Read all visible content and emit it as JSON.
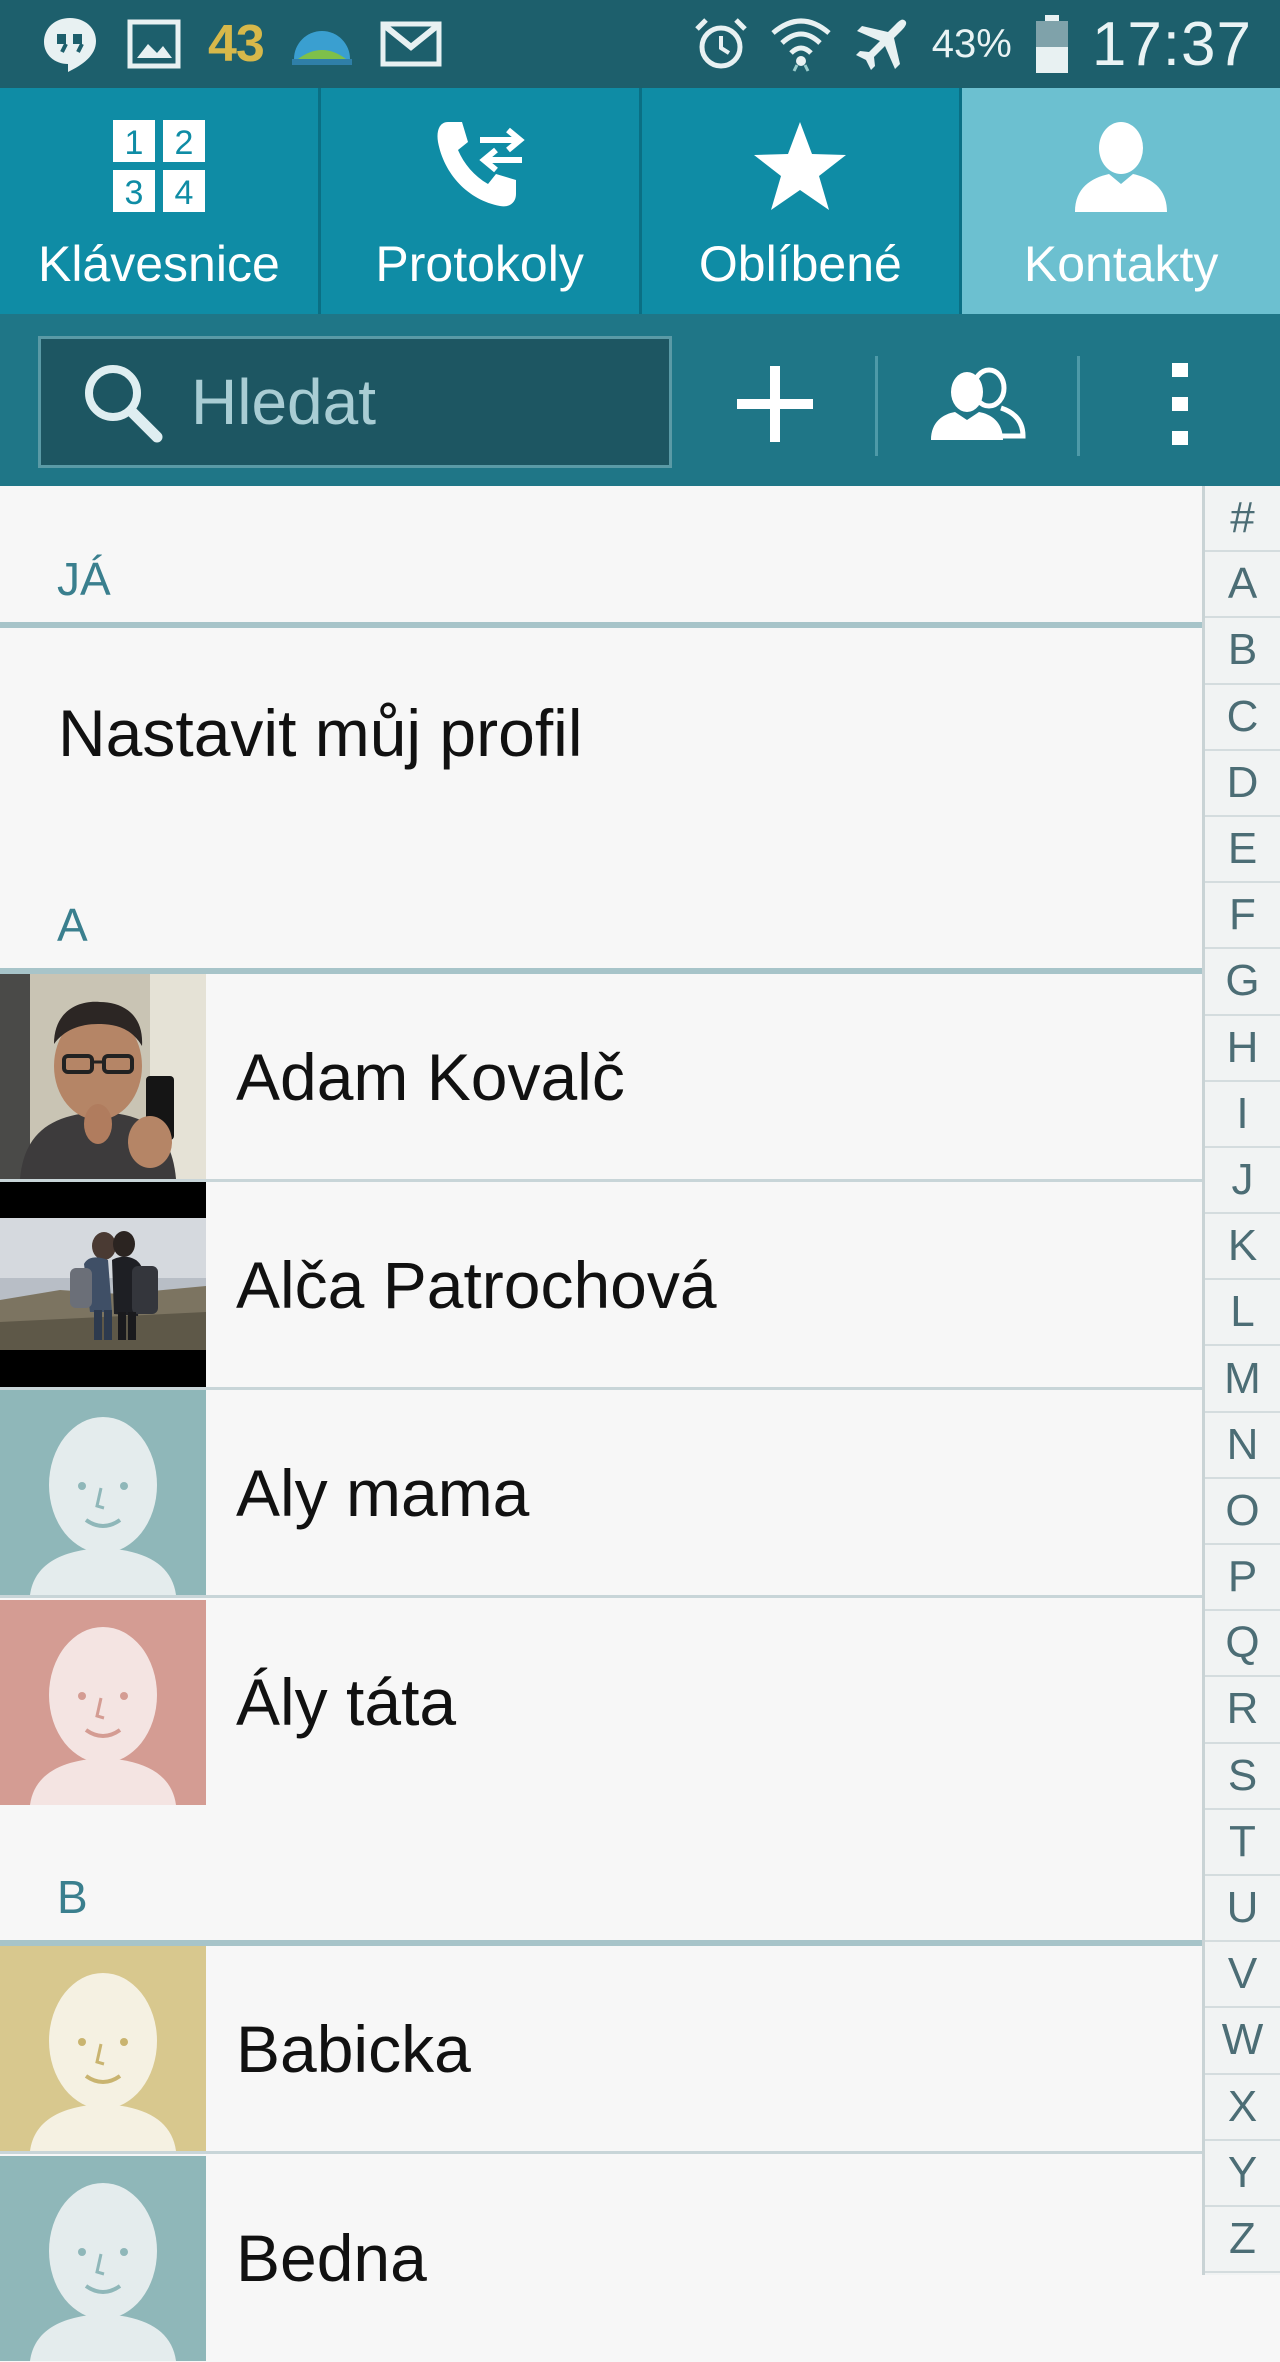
{
  "status_bar": {
    "left_icons": [
      "hangouts-icon",
      "gallery-icon",
      "weather-icon",
      "gmail-icon"
    ],
    "notification_count": "43",
    "right_icons": [
      "alarm-icon",
      "wifi-icon",
      "airplane-icon",
      "battery-icon"
    ],
    "battery_percent": "43%",
    "time": "17:37"
  },
  "tabs": [
    {
      "label": "Klávesnice",
      "icon": "keypad-icon",
      "active": false
    },
    {
      "label": "Protokoly",
      "icon": "call-log-icon",
      "active": false
    },
    {
      "label": "Oblíbené",
      "icon": "star-icon",
      "active": false
    },
    {
      "label": "Kontakty",
      "icon": "person-icon",
      "active": true
    }
  ],
  "toolbar": {
    "search_placeholder": "Hledat",
    "add_icon": "plus-icon",
    "groups_icon": "groups-icon",
    "menu_icon": "more-vertical-icon"
  },
  "sections": {
    "me": {
      "header": "JÁ",
      "profile_label": "Nastavit můj profil"
    },
    "a": {
      "header": "A"
    },
    "b": {
      "header": "B"
    }
  },
  "contacts": [
    {
      "name": "Adam Kovalč",
      "avatar": "photo-avatar"
    },
    {
      "name": "Alča Patrochová",
      "avatar": "photo-avatar"
    },
    {
      "name": "Aly mama",
      "avatar": "default-avatar",
      "avatar_color": "#8fb7b9"
    },
    {
      "name": "Ály táta",
      "avatar": "default-avatar",
      "avatar_color": "#d49c93"
    },
    {
      "name": "Babicka",
      "avatar": "default-avatar",
      "avatar_color": "#d8c88e"
    },
    {
      "name": "Bedna",
      "avatar": "default-avatar",
      "avatar_color": "#8fb7b9"
    }
  ],
  "alphabet_index": [
    "#",
    "A",
    "B",
    "C",
    "D",
    "E",
    "F",
    "G",
    "H",
    "I",
    "J",
    "K",
    "L",
    "M",
    "N",
    "O",
    "P",
    "Q",
    "R",
    "S",
    "T",
    "U",
    "V",
    "W",
    "X",
    "Y",
    "Z"
  ],
  "colors": {
    "status_bar": "#1d5f6c",
    "tab_bar": "#0f8ca5",
    "tab_active": "#6cc0d0",
    "toolbar": "#1f7687",
    "section_text": "#3a7f8e"
  }
}
